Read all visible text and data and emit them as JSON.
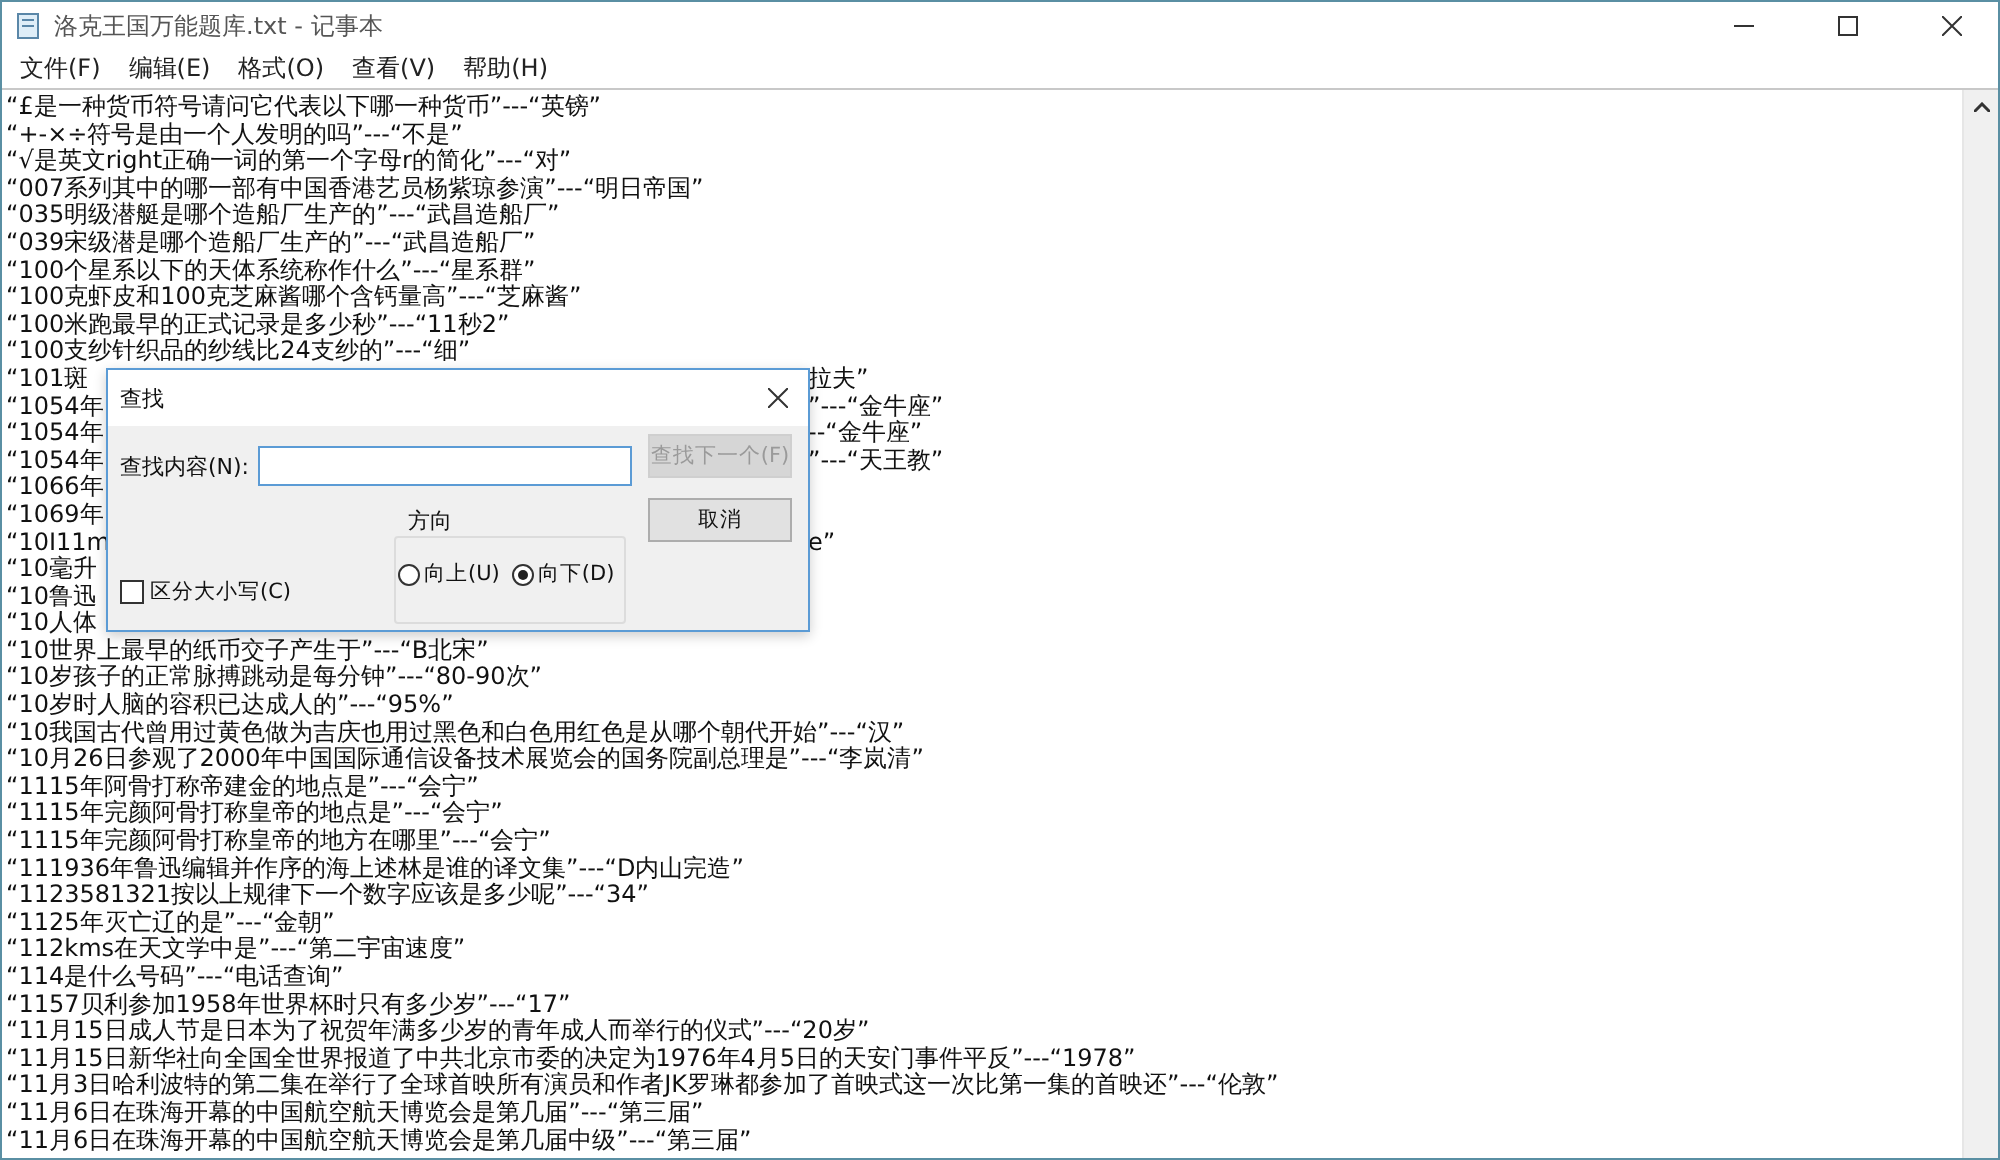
{
  "window": {
    "title": "洛克王国万能题库.txt - 记事本"
  },
  "menu": [
    "文件(F)",
    "编辑(E)",
    "格式(O)",
    "查看(V)",
    "帮助(H)"
  ],
  "lines": [
    {
      "text": "“£是一种货币符号请问它代表以下哪一种货币”---“英镑”"
    },
    {
      "text": "“+-×÷符号是由一个人发明的吗”---“不是”"
    },
    {
      "text": "“√是英文right正确一词的第一个字母r的简化”---“对”"
    },
    {
      "text": "“007系列其中的哪一部有中国香港艺员杨紫琼参演”---“明日帝国”"
    },
    {
      "text": "“035明级潜艇是哪个造船厂生产的”---“武昌造船厂”"
    },
    {
      "text": "“039宋级潜是哪个造船厂生产的”---“武昌造船厂”"
    },
    {
      "text": "“100个星系以下的天体系统称作什么”---“星系群”"
    },
    {
      "text": "“100克虾皮和100克芝麻酱哪个含钙量高”---“芝麻酱”"
    },
    {
      "text": "“100米跑最早的正式记录是多少秒”---“11秒2”"
    },
    {
      "text": "“100支纱针织品的纱线比24支纱的”---“细”"
    },
    {
      "text": "“101斑",
      "right": "拉夫”"
    },
    {
      "text": "“1054年",
      "right": "”---“金牛座”"
    },
    {
      "text": "“1054年",
      "right": "--“金牛座”"
    },
    {
      "text": "“1054年",
      "right": "”---“天王教”"
    },
    {
      "text": "“1066年"
    },
    {
      "text": "“1069年"
    },
    {
      "text": "“10I11m",
      "right": "e”"
    },
    {
      "text": "“10毫升"
    },
    {
      "text": "“10鲁迅"
    },
    {
      "text": "“10人体"
    },
    {
      "text": "“10世界上最早的纸币交子产生于”---“B北宋”"
    },
    {
      "text": "“10岁孩子的正常脉搏跳动是每分钟”---“80-90次”"
    },
    {
      "text": "“10岁时人脑的容积已达成人的”---“95%”"
    },
    {
      "text": "“10我国古代曾用过黄色做为吉庆也用过黑色和白色用红色是从哪个朝代开始”---“汉”"
    },
    {
      "text": "“10月26日参观了2000年中国国际通信设备技术展览会的国务院副总理是”---“李岚清”"
    },
    {
      "text": "“1115年阿骨打称帝建金的地点是”---“会宁”"
    },
    {
      "text": "“1115年完颜阿骨打称皇帝的地点是”---“会宁”"
    },
    {
      "text": "“1115年完颜阿骨打称皇帝的地方在哪里”---“会宁”"
    },
    {
      "text": "“111936年鲁迅编辑并作序的海上述林是谁的译文集”---“D内山完造”"
    },
    {
      "text": "“1123581321按以上规律下一个数字应该是多少呢”---“34”"
    },
    {
      "text": "“1125年灭亡辽的是”---“金朝”"
    },
    {
      "text": "“112kms在天文学中是”---“第二宇宙速度”"
    },
    {
      "text": "“114是什么号码”---“电话查询”"
    },
    {
      "text": "“1157贝利参加1958年世界杯时只有多少岁”---“17”"
    },
    {
      "text": "“11月15日成人节是日本为了祝贺年满多少岁的青年成人而举行的仪式”---“20岁”"
    },
    {
      "text": "“11月15日新华社向全国全世界报道了中共北京市委的决定为1976年4月5日的天安门事件平反”---“1978”"
    },
    {
      "text": "“11月3日哈利波特的第二集在举行了全球首映所有演员和作者JK罗琳都参加了首映式这一次比第一集的首映还”---“伦敦”"
    },
    {
      "text": "“11月6日在珠海开幕的中国航空航天博览会是第几届”---“第三届”"
    },
    {
      "text": "“11月6日在珠海开幕的中国航空航天博览会是第几届中级”---“第三届”"
    }
  ],
  "dialog": {
    "title": "查找",
    "find_label": "查找内容(N):",
    "find_next": {
      "label": "查找下一个(F)",
      "disabled": true
    },
    "cancel": {
      "label": "取消",
      "disabled": false
    },
    "direction": {
      "label": "方向",
      "options": [
        {
          "label": "向上(U)",
          "selected": false
        },
        {
          "label": "向下(D)",
          "selected": true
        }
      ]
    },
    "match_case": {
      "label": "区分大小写(C)",
      "checked": false
    }
  }
}
